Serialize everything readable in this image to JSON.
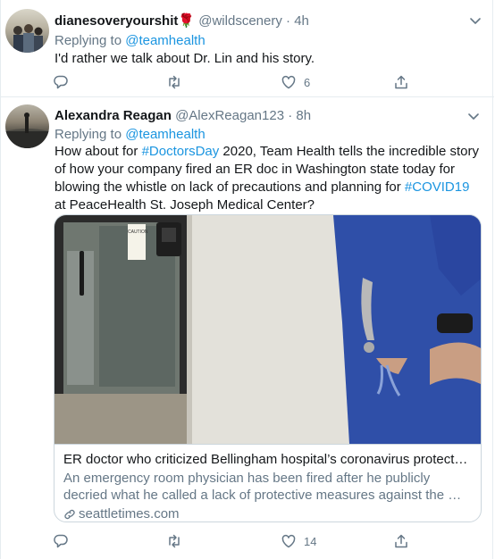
{
  "tweets": [
    {
      "display_name": "dianesoveryourshit",
      "name_emoji": "🌹",
      "handle": "@wildscenery",
      "time": "4h",
      "replying_label": "Replying to",
      "replying_to": "@teamhealth",
      "text": "I'd rather we talk about Dr. Lin and his story.",
      "actions": {
        "replies": "",
        "retweets": "",
        "likes": "6"
      }
    },
    {
      "display_name": "Alexandra Reagan",
      "handle": "@AlexReagan123",
      "time": "8h",
      "replying_label": "Replying to",
      "replying_to": "@teamhealth",
      "text_parts": {
        "p1": "How about for ",
        "hashtag1": "#DoctorsDay",
        "p2": " 2020, Team Health tells the incredible story of how your company fired an ER doc in Washington state today for blowing the whistle on lack of precautions and planning for ",
        "hashtag2": "#COVID19",
        "p3": " at PeaceHealth St. Joseph Medical Center?"
      },
      "card": {
        "title": "ER doctor who criticized Bellingham hospital’s coronavirus protect…",
        "description": "An emergency room physician has been fired after he publicly decried what he called a lack of protective measures against the …",
        "domain": "seattletimes.com",
        "sign_text": "CAUTION"
      },
      "actions": {
        "replies": "",
        "retweets": "",
        "likes": "14"
      }
    }
  ],
  "colors": {
    "link": "#1b95e0",
    "muted": "#657786",
    "text": "#14171a",
    "border": "#e6ecf0"
  },
  "icons": [
    "reply-icon",
    "retweet-icon",
    "like-icon",
    "share-icon",
    "caret-down-icon",
    "link-icon"
  ]
}
